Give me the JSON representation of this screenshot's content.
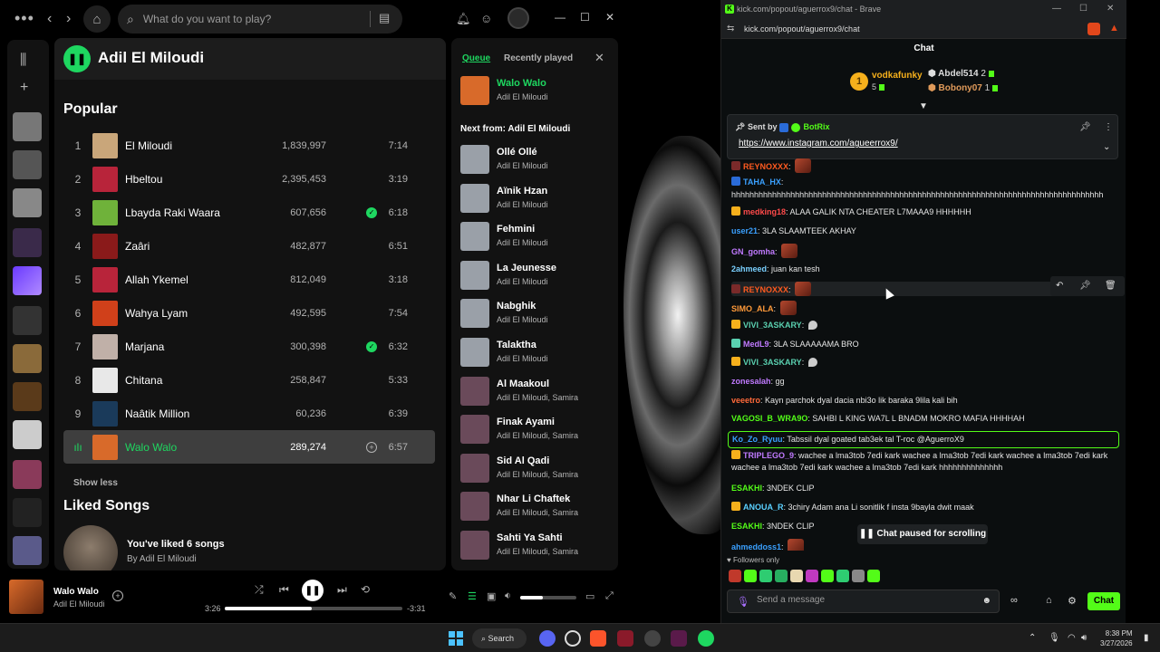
{
  "spotify": {
    "search_placeholder": "What do you want to play?",
    "artist_name": "Adil El Miloudi",
    "popular_heading": "Popular",
    "tracks": [
      {
        "num": "1",
        "title": "El Miloudi",
        "plays": "1,839,997",
        "duration": "7:14",
        "liked": false,
        "art": "#c9a67a"
      },
      {
        "num": "2",
        "title": "Hbeltou",
        "plays": "2,395,453",
        "duration": "3:19",
        "liked": false,
        "art": "#b8243a"
      },
      {
        "num": "3",
        "title": "Lbayda Raki Waara",
        "plays": "607,656",
        "duration": "6:18",
        "liked": true,
        "art": "#6fb23a"
      },
      {
        "num": "4",
        "title": "Zaâri",
        "plays": "482,877",
        "duration": "6:51",
        "liked": false,
        "art": "#8a1a1a"
      },
      {
        "num": "5",
        "title": "Allah Ykemel",
        "plays": "812,049",
        "duration": "3:18",
        "liked": false,
        "art": "#b8243a"
      },
      {
        "num": "6",
        "title": "Wahya Lyam",
        "plays": "492,595",
        "duration": "7:54",
        "liked": false,
        "art": "#d0401a"
      },
      {
        "num": "7",
        "title": "Marjana",
        "plays": "300,398",
        "duration": "6:32",
        "liked": true,
        "art": "#c0b0a8"
      },
      {
        "num": "8",
        "title": "Chitana",
        "plays": "258,847",
        "duration": "5:33",
        "liked": false,
        "art": "#e8e8e8"
      },
      {
        "num": "9",
        "title": "Naâtik Million",
        "plays": "60,236",
        "duration": "6:39",
        "liked": false,
        "art": "#1a3a5a"
      },
      {
        "num": "",
        "title": "Walo Walo",
        "plays": "289,274",
        "duration": "6:57",
        "liked": false,
        "art": "#d86a2a"
      }
    ],
    "show_less": "Show less",
    "liked_heading": "Liked Songs",
    "liked_main": "You've liked 6 songs",
    "liked_sub": "By Adil El Miloudi",
    "queue": {
      "tab_queue": "Queue",
      "tab_recent": "Recently played",
      "now_playing": {
        "title": "Walo Walo",
        "artist": "Adil El Miloudi"
      },
      "next_heading": "Next from: Adil El Miloudi",
      "items": [
        {
          "title": "Ollé Ollé",
          "artist": "Adil El Miloudi",
          "art": "#9aa0a8"
        },
        {
          "title": "Aïnik Hzan",
          "artist": "Adil El Miloudi",
          "art": "#9aa0a8"
        },
        {
          "title": "Fehmini",
          "artist": "Adil El Miloudi",
          "art": "#9aa0a8"
        },
        {
          "title": "La Jeunesse",
          "artist": "Adil El Miloudi",
          "art": "#9aa0a8"
        },
        {
          "title": "Nabghik",
          "artist": "Adil El Miloudi",
          "art": "#9aa0a8"
        },
        {
          "title": "Talaktha",
          "artist": "Adil El Miloudi",
          "art": "#9aa0a8"
        },
        {
          "title": "Al Maakoul",
          "artist": "Adil El Miloudi, Samira",
          "art": "#6a4a5a"
        },
        {
          "title": "Finak Ayami",
          "artist": "Adil El Miloudi, Samira",
          "art": "#6a4a5a"
        },
        {
          "title": "Sid Al Qadi",
          "artist": "Adil El Miloudi, Samira",
          "art": "#6a4a5a"
        },
        {
          "title": "Nhar Li Chaftek",
          "artist": "Adil El Miloudi, Samira",
          "art": "#6a4a5a"
        },
        {
          "title": "Sahti Ya Sahti",
          "artist": "Adil El Miloudi, Samira",
          "art": "#6a4a5a"
        }
      ]
    },
    "player": {
      "title": "Walo Walo",
      "artist": "Adil El Miloudi",
      "elapsed": "3:26",
      "remaining": "-3:31",
      "progress": 0.49,
      "volume": 0.4
    }
  },
  "brave": {
    "tab_title": "kick.com/popout/aguerrox9/chat - Brave",
    "url": "kick.com/popout/aguerrox9/chat",
    "kick_header": "Chat",
    "leaderboard": [
      {
        "name": "vodkafunky",
        "count": "5",
        "color": "#f6b01c"
      },
      {
        "name": "Abdel514",
        "count": "2",
        "color": "#dddddd"
      },
      {
        "name": "Bobony07",
        "count": "1",
        "color": "#e09a5a"
      }
    ],
    "pinned": {
      "sent_by": "Sent by",
      "bot": "BotRix",
      "link": "https://www.instagram.com/agueerrox9/"
    },
    "messages": [
      {
        "user": "REYNOXXX",
        "color": "#ff5a1f",
        "text": "",
        "emote": true,
        "badge": "#7a2a2a"
      },
      {
        "user": "TAHA_HX",
        "color": "#3aa0ff",
        "text": "",
        "emote": false,
        "badge": "#2a6bd8"
      },
      {
        "user": "",
        "color": "#e6e6e6",
        "text": "hhhhhhhhhhhhhhhhhhhhhhhhhhhhhhhhhhhhhhhhhhhhhhhhhhhhhhhhhhhhhhhhhhhhhhhhhhhhhhhhhh",
        "emote": false,
        "badge": ""
      },
      {
        "user": "medking18",
        "color": "#ff4a4a",
        "text": "ALAA GALIK NTA CHEATER L7MAAA9 HHHHHH",
        "emote": false,
        "badge": "#f6b01c"
      },
      {
        "user": "user21",
        "color": "#3aa0ff",
        "text": "3LA SLAAMTEEK AKHAY",
        "emote": false,
        "badge": ""
      },
      {
        "user": "GN_gomha",
        "color": "#c07aff",
        "text": "",
        "emote": true,
        "badge": ""
      },
      {
        "user": "2ahmeed",
        "color": "#7ad0ff",
        "text": "juan kan tesh",
        "emote": false,
        "badge": ""
      },
      {
        "user": "REYNOXXX",
        "color": "#ff5a1f",
        "text": "",
        "emote": true,
        "badge": "#7a2a2a"
      },
      {
        "user": "SIMO_ALA",
        "color": "#ff9a3a",
        "text": "",
        "emote": true,
        "badge": ""
      },
      {
        "user": "VIVI_3ASKARY",
        "color": "#5ad0b0",
        "text": "",
        "emote": false,
        "badge": "#f6b01c",
        "feather": true
      },
      {
        "user": "MedL9",
        "color": "#c07aff",
        "text": "3LA SLAAAAAMA BRO",
        "emote": false,
        "badge": "#5ad0b0"
      },
      {
        "user": "VIVI_3ASKARY",
        "color": "#5ad0b0",
        "text": "",
        "emote": false,
        "badge": "#f6b01c",
        "feather": true
      },
      {
        "user": "zonesalah",
        "color": "#c07aff",
        "text": "gg",
        "emote": false,
        "badge": ""
      },
      {
        "user": "veeetro",
        "color": "#ff6a3a",
        "text": "Kayn parchok dyal dacia nbi3o lik baraka 9lila kali bih",
        "emote": false,
        "badge": ""
      },
      {
        "user": "VAGOSI_B_WRA9O",
        "color": "#53fc18",
        "text": "SAHBI L KING WA7L L BNADM MOKRO MAFIA HHHHAH",
        "emote": false,
        "badge": ""
      },
      {
        "user": "Ko_Zo_Ryuu",
        "color": "#3aa0ff",
        "text": "Tabssil dyal goated tab3ek tal T-roc @AguerroX9",
        "emote": false,
        "badge": ""
      },
      {
        "user": "TRIPLEGO_9",
        "color": "#c07aff",
        "text": "wachee a lma3tob 7edi kark wachee a lma3tob 7edi kark wachee a lma3tob 7edi kark wachee a lma3tob 7edi kark wachee a lma3tob 7edi kark hhhhhhhhhhhhhh",
        "emote": false,
        "badge": "#f6b01c"
      },
      {
        "user": "ESAKHI",
        "color": "#53fc18",
        "text": "3NDEK CLIP",
        "emote": false,
        "badge": ""
      },
      {
        "user": "ANOUA_R",
        "color": "#5ad0ff",
        "text": "3chiry Adam ana Li sonitlik f insta 9bayla dwit maak",
        "emote": false,
        "badge": "#f6b01c"
      },
      {
        "user": "ESAKHI",
        "color": "#53fc18",
        "text": "3NDEK CLIP",
        "emote": false,
        "badge": ""
      },
      {
        "user": "ahmeddoss1",
        "color": "#3aa0ff",
        "text": "",
        "emote": true,
        "badge": ""
      }
    ],
    "paused_label": "Chat paused for scrolling",
    "followers_only": "Followers only",
    "send_placeholder": "Send a message",
    "chat_button": "Chat"
  },
  "taskbar": {
    "search": "Search",
    "time": "8:38 PM",
    "date": "3/27/2026"
  }
}
